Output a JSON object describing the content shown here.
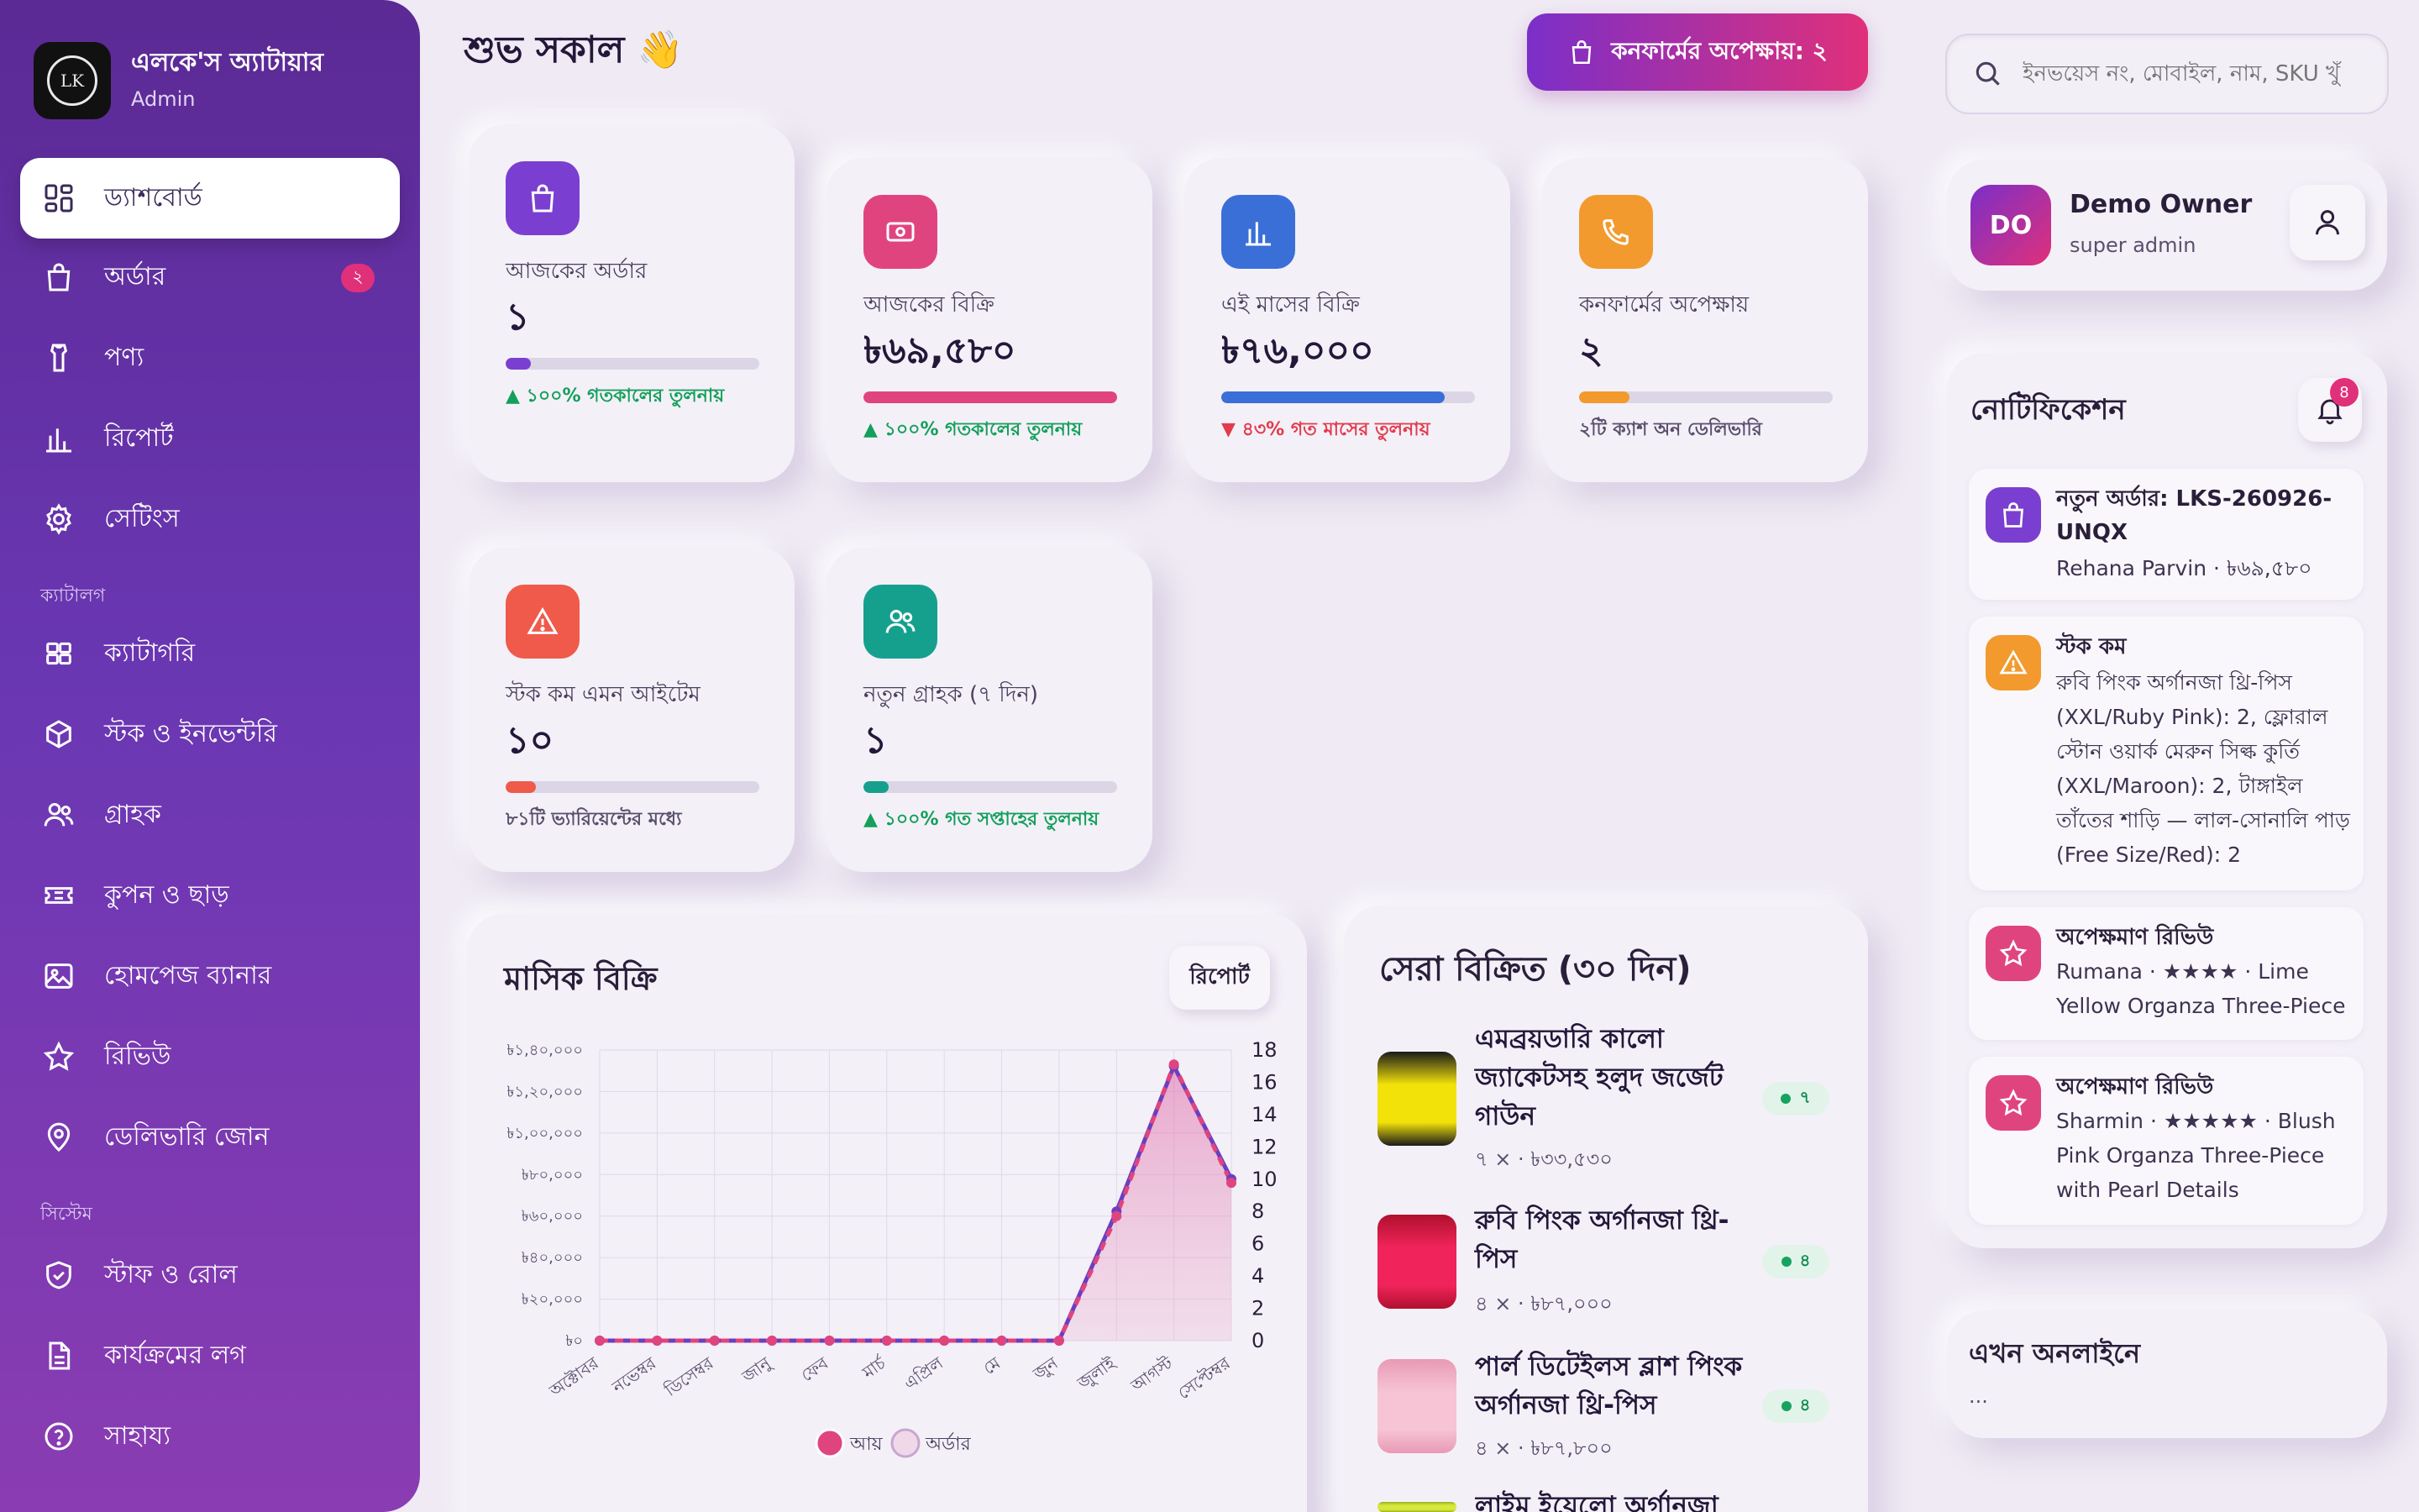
{
  "brand": {
    "name": "এলকে'স অ্যাটায়ার",
    "role": "Admin"
  },
  "nav": {
    "items": [
      {
        "label": "ড্যাশবোর্ড",
        "icon": "dashboard-icon",
        "active": true
      },
      {
        "label": "অর্ডার",
        "icon": "shopping-bag-icon",
        "badge": "২"
      },
      {
        "label": "পণ্য",
        "icon": "shirt-icon"
      },
      {
        "label": "রিপোর্ট",
        "icon": "bar-chart-icon"
      },
      {
        "label": "সেটিংস",
        "icon": "gear-icon"
      }
    ],
    "catalog_label": "ক্যাটালগ",
    "catalog_items": [
      {
        "label": "ক্যাটাগরি",
        "icon": "grid-icon"
      },
      {
        "label": "স্টক ও ইনভেন্টরি",
        "icon": "box-icon"
      },
      {
        "label": "গ্রাহক",
        "icon": "users-icon"
      },
      {
        "label": "কুপন ও ছাড়",
        "icon": "ticket-icon"
      },
      {
        "label": "হোমপেজ ব্যানার",
        "icon": "image-icon"
      },
      {
        "label": "রিভিউ",
        "icon": "star-icon"
      },
      {
        "label": "ডেলিভারি জোন",
        "icon": "map-pin-icon"
      }
    ],
    "system_label": "সিস্টেম",
    "system_items": [
      {
        "label": "স্টাফ ও রোল",
        "icon": "shield-icon"
      },
      {
        "label": "কার্যক্রমের লগ",
        "icon": "document-icon"
      },
      {
        "label": "সাহায্য",
        "icon": "help-icon"
      }
    ]
  },
  "header": {
    "greeting": "শুভ সকাল 👋",
    "pending_button": "কনফার্মের অপেক্ষায়: ২",
    "search_placeholder": "ইনভয়েস নং, মোবাইল, নাম, SKU খুঁ"
  },
  "stats": [
    {
      "label": "আজকের অর্ডার",
      "value": "১",
      "note": "▲ ১০০% গতকালের তুলনায়",
      "trend": "up",
      "progress": 0.1,
      "color": "#7a3fd0",
      "icon": "shopping-bag-icon"
    },
    {
      "label": "আজকের বিক্রি",
      "value": "৳৬৯,৫৮০",
      "note": "▲ ১০০% গতকালের তুলনায়",
      "trend": "up",
      "progress": 1.0,
      "color": "#e0447e",
      "icon": "money-icon"
    },
    {
      "label": "এই মাসের বিক্রি",
      "value": "৳৭৬,০০০",
      "note": "▼ ৪৩% গত মাসের তুলনায়",
      "trend": "down",
      "progress": 0.88,
      "color": "#3a6fd8",
      "icon": "bar-chart-icon"
    },
    {
      "label": "কনফার্মের অপেক্ষায়",
      "value": "২",
      "note": "২টি ক্যাশ অন ডেলিভারি",
      "trend": "muted",
      "progress": 0.2,
      "color": "#f29a2e",
      "icon": "phone-icon"
    },
    {
      "label": "স্টক কম এমন আইটেম",
      "value": "১০",
      "note": "৮১টি ভ্যারিয়েন্টের মধ্যে",
      "trend": "muted",
      "progress": 0.12,
      "color": "#ef5a4b",
      "icon": "warning-icon"
    },
    {
      "label": "নতুন গ্রাহক (৭ দিন)",
      "value": "১",
      "note": "▲ ১০০% গত সপ্তাহের তুলনায়",
      "trend": "up",
      "progress": 0.1,
      "color": "#15a08e",
      "icon": "users-icon"
    }
  ],
  "owner": {
    "initials": "DO",
    "name": "Demo Owner",
    "role": "super admin"
  },
  "notifications": {
    "title": "নোটিফিকেশন",
    "count": "8",
    "items": [
      {
        "title": "নতুন অর্ডার: LKS-260926-UNQX",
        "body": "Rehana Parvin · ৳৬৯,৫৮০",
        "icon": "shopping-bag-icon",
        "color": "#7a3fd0"
      },
      {
        "title": "স্টক কম",
        "body": "রুবি পিংক অর্গানজা থ্রি-পিস (XXL/Ruby Pink): 2, ফ্লোরাল স্টোন ওয়ার্ক মেরুন সিল্ক কুর্তি (XXL/Maroon): 2, টাঙ্গাইল তাঁতের শাড়ি — লাল-সোনালি পাড় (Free Size/Red): 2",
        "icon": "warning-icon",
        "color": "#f29a2e"
      },
      {
        "title": "অপেক্ষমাণ রিভিউ",
        "body": "Rumana · ★★★★ · Lime Yellow Organza Three-Piece",
        "icon": "star-icon",
        "color": "#e0447e"
      },
      {
        "title": "অপেক্ষমাণ রিভিউ",
        "body": "Sharmin · ★★★★★ · Blush Pink Organza Three-Piece with Pearl Details",
        "icon": "star-icon",
        "color": "#e0447e"
      }
    ]
  },
  "online": {
    "title": "এখন অনলাইনে",
    "text": "..."
  },
  "monthly": {
    "title": "মাসিক বিক্রি",
    "report_button": "রিপোর্ট"
  },
  "chart_data": {
    "type": "line",
    "categories": [
      "অক্টোবর",
      "নভেম্বর",
      "ডিসেম্বর",
      "জানু",
      "ফেব",
      "মার্চ",
      "এপ্রিল",
      "মে",
      "জুন",
      "জুলাই",
      "আগস্ট",
      "সেপ্টেম্বর"
    ],
    "series": [
      {
        "name": "আয়",
        "axis": "left",
        "color": "#e0447e",
        "style": "dashed",
        "values": [
          0,
          0,
          0,
          0,
          0,
          0,
          0,
          0,
          0,
          60000,
          133000,
          76000
        ]
      },
      {
        "name": "অর্ডার",
        "axis": "right",
        "color": "#6a3fc0",
        "style": "solid-area",
        "values": [
          0,
          0,
          0,
          0,
          0,
          0,
          0,
          0,
          0,
          8,
          17,
          10
        ]
      }
    ],
    "ylim_left": [
      0,
      140000
    ],
    "left_ticks": [
      "৳০",
      "৳২০,০০০",
      "৳৪০,০০০",
      "৳৬০,০০০",
      "৳৮০,০০০",
      "৳১,০০,০০০",
      "৳১,২০,০০০",
      "৳১,৪০,০০০"
    ],
    "ylim_right": [
      0,
      18
    ],
    "right_ticks": [
      "0",
      "2",
      "4",
      "6",
      "8",
      "10",
      "12",
      "14",
      "16",
      "18"
    ],
    "grid": true,
    "legend": "bottom"
  },
  "top_sellers": {
    "title": "সেরা বিক্রিত (৩০ দিন)",
    "items": [
      {
        "name": "এমব্রয়ডারি কালো জ্যাকেটসহ হলুদ জর্জেট গাউন",
        "meta": "৭ × · ৳৩৩,৫৩০",
        "count": "৭",
        "img_a": "#f3e20a",
        "img_b": "#1a1a1a"
      },
      {
        "name": "রুবি পিংক অর্গানজা থ্রি-পিস",
        "meta": "৪ × · ৳৮৭,০০০",
        "count": "৪",
        "img_a": "#f0245a",
        "img_b": "#b0102e"
      },
      {
        "name": "পার্ল ডিটেইলস ব্লাশ পিংক অর্গানজা থ্রি-পিস",
        "meta": "৪ × · ৳৮৭,৮০০",
        "count": "৪",
        "img_a": "#f6c4d4",
        "img_b": "#e89ab4"
      },
      {
        "name": "লাইম ইয়েলো অর্গানজা থ্রি",
        "meta": "",
        "count": "",
        "img_a": "#d8e83a",
        "img_b": "#9ab020"
      }
    ]
  }
}
